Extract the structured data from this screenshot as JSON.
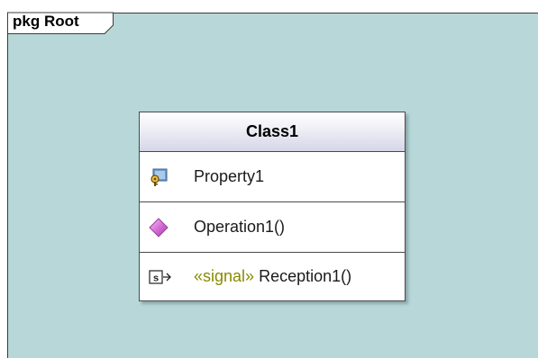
{
  "package": {
    "label": "pkg Root"
  },
  "class": {
    "name": "Class1",
    "attributes": [
      {
        "name": "Property1",
        "icon": "property-key-icon"
      }
    ],
    "operations": [
      {
        "name": "Operation1()",
        "icon": "operation-diamond-icon"
      }
    ],
    "receptions": [
      {
        "stereotype": "«signal»",
        "name": "Reception1()",
        "icon": "signal-reception-icon"
      }
    ]
  },
  "colors": {
    "background": "#b8d7d9",
    "header_gradient_end": "#d6d6e8",
    "stereotype": "#8a8a00",
    "operation_icon": "#d66fd6"
  }
}
